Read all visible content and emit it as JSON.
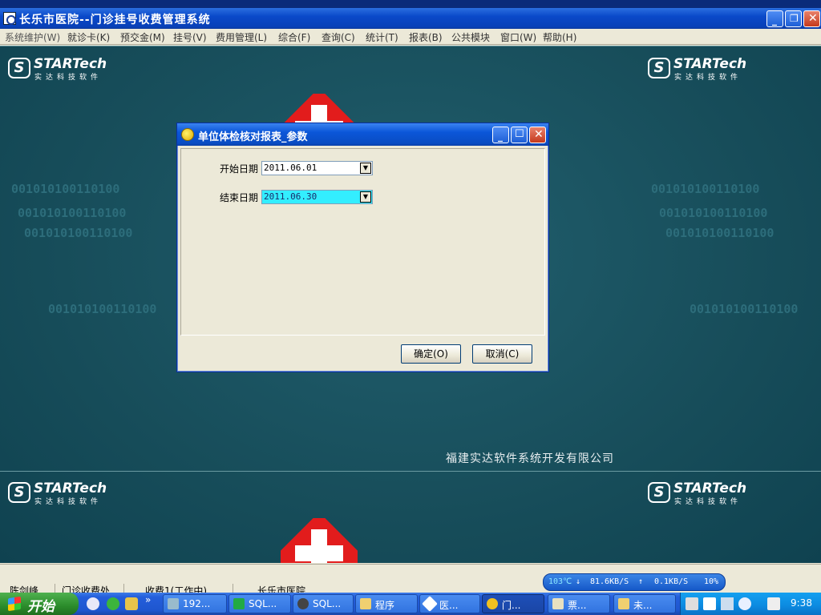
{
  "window": {
    "title": "长乐市医院--门诊挂号收费管理系统"
  },
  "menu": [
    "系统维护(W)",
    "就诊卡(K)",
    "预交金(M)",
    "挂号(V)",
    "费用管理(L)",
    "综合(F)",
    "查询(C)",
    "统计(T)",
    "报表(B)",
    "公共模块",
    "窗口(W)",
    "帮助(H)"
  ],
  "branding": {
    "logo_word": "STARTech",
    "logo_sub": "实达科技软件",
    "company": "福建实达软件系统开发有限公司",
    "binary": "001010100110100"
  },
  "dialog": {
    "title": "单位体检核对报表_参数",
    "start_label": "开始日期",
    "start_value": "2011.06.01",
    "end_label": "结束日期",
    "end_value": "2011.06.30",
    "ok_label": "确定(O)",
    "cancel_label": "取消(C)"
  },
  "statusbar": {
    "fields": [
      "陈剑峰",
      "门诊收费处",
      "收费1(工作中)",
      "长乐市医院"
    ]
  },
  "netmon": {
    "temp": "103℃",
    "down": "81.6KB/S",
    "up": "0.1KB/S",
    "cpu": "10%"
  },
  "taskbar": {
    "start_label": "开始",
    "items": [
      "192...",
      "SQL...",
      "SQL...",
      "程序",
      "医...",
      "门...",
      "票...",
      "未..."
    ],
    "clock": "9:38"
  }
}
